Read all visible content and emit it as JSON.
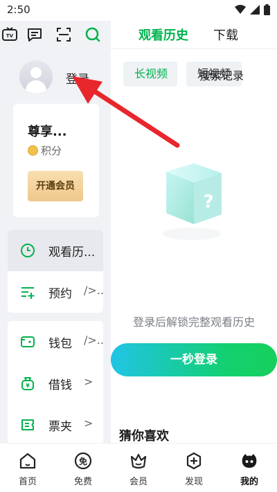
{
  "status_bar": {
    "time": "2:50"
  },
  "drawer": {
    "top_icons": [
      "tv-icon",
      "message-icon",
      "scan-icon",
      "search-icon"
    ],
    "profile": {
      "login_label": "登录"
    },
    "vip_card": {
      "title": "尊享...",
      "points_label": "积分",
      "button_label": "开通会员"
    },
    "menu_primary": [
      {
        "icon": "clock-icon",
        "label": "观看历...",
        "active": true
      },
      {
        "icon": "reserve-icon",
        "label": "预约",
        "chevron": "/>..."
      }
    ],
    "menu_secondary": [
      {
        "icon": "wallet-icon",
        "label": "钱包",
        "chevron": "/>..."
      },
      {
        "icon": "money-bag-icon",
        "label": "借钱",
        "chevron": ">"
      },
      {
        "icon": "ticket-icon",
        "label": "票夹",
        "chevron": ">"
      }
    ]
  },
  "panel": {
    "tabs": [
      {
        "label": "观看历史",
        "active": true
      },
      {
        "label": "下载",
        "active": false
      }
    ],
    "chips": [
      {
        "label": "长视频",
        "active": true
      },
      {
        "label": "短视频",
        "active": false
      }
    ],
    "search_history_label": "搜索记录",
    "empty_text": "登录后解锁完整观看历史",
    "login_button_label": "一秒登录",
    "guess_title": "猜你喜欢"
  },
  "bottom_nav": [
    {
      "icon": "home-icon",
      "label": "首页",
      "active": false
    },
    {
      "icon": "free-icon",
      "label": "免费",
      "active": false
    },
    {
      "icon": "vip-crown-icon",
      "label": "会员",
      "active": false
    },
    {
      "icon": "discover-icon",
      "label": "发现",
      "active": false
    },
    {
      "icon": "my-profile-icon",
      "label": "我的",
      "active": true
    }
  ],
  "colors": {
    "accent": "#00b24d",
    "drawer_bg": "#f1f2f5",
    "vip_gold": "#eec78b",
    "annotation_arrow": "#e8262b"
  }
}
